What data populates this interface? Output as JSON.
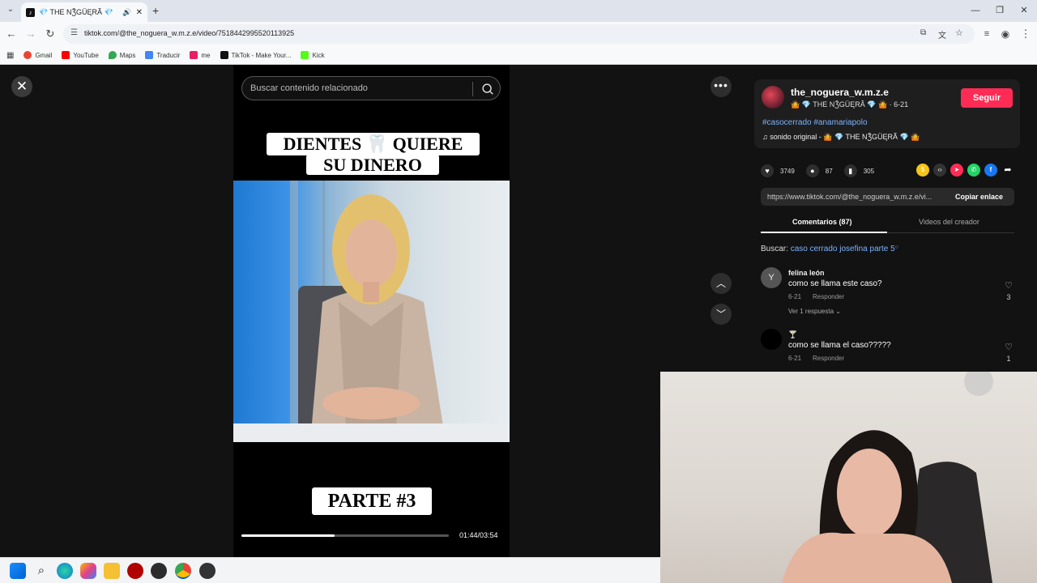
{
  "browser": {
    "tab_title": "💎 THE NǮGÜĘRÃ 💎",
    "url": "tiktok.com/@the_noguera_w.m.z.e/video/7518442995520113925"
  },
  "bookmarks": [
    {
      "label": "Gmail",
      "color": "#ea4335"
    },
    {
      "label": "YouTube",
      "color": "#ff0000"
    },
    {
      "label": "Maps",
      "color": "#34a853"
    },
    {
      "label": "Traducir",
      "color": "#4285f4"
    },
    {
      "label": "me",
      "color": "#e91e63"
    },
    {
      "label": "TikTok - Make Your...",
      "color": "#111111"
    },
    {
      "label": "Kick",
      "color": "#53fc18"
    }
  ],
  "video": {
    "search_placeholder": "Buscar contenido relacionado",
    "caption_top_line1": "DIENTES 🦷 QUIERE",
    "caption_top_line2": "SU DINERO",
    "caption_bottom": "PARTE #3",
    "time": "01:44/03:54",
    "progress": 0.45
  },
  "panel": {
    "username": "the_noguera_w.m.z.e",
    "subline": "🤷 💎 THE NǮGÜĘRÃ 💎 🤷 · 6-21",
    "follow": "Seguir",
    "tags": "#casocerrado #anamariapolo",
    "sound": "♫  sonido original - 🤷 💎 THE NǮGÜĘRÃ 💎 🤷",
    "likes": "3749",
    "comments": "87",
    "saves": "305",
    "link": "https://www.tiktok.com/@the_noguera_w.m.z.e/vi...",
    "copy": "Copiar enlace",
    "tab_comments": "Comentarios (87)",
    "tab_videos": "Videos del creador",
    "search_prefix": "Buscar:",
    "search_term": "caso cerrado josefina parte 5"
  },
  "comments": [
    {
      "avatar": "Y",
      "name": "felina león",
      "text": "como se llama este caso?",
      "date": "6-21",
      "reply": "Responder",
      "likes": "3",
      "more": "Ver 1 respuesta ⌄"
    },
    {
      "avatar": "",
      "name": "🍸",
      "text": "como se llama el caso?????",
      "date": "6-21",
      "reply": "Responder",
      "likes": "1",
      "more": ""
    }
  ]
}
